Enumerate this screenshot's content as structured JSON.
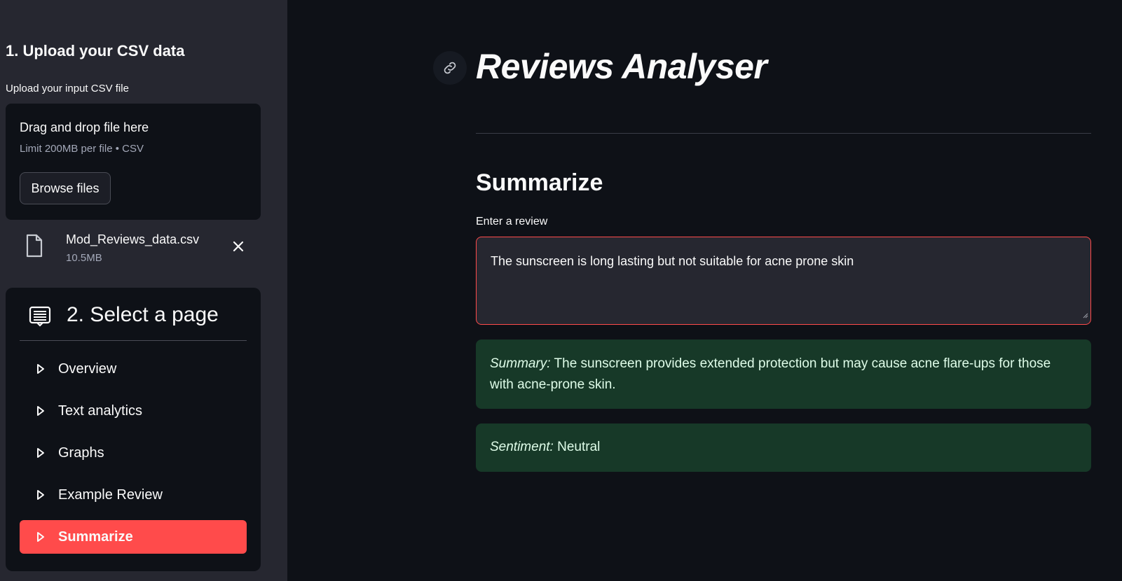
{
  "sidebar": {
    "upload_heading": "1. Upload your CSV data",
    "upload_label": "Upload your input CSV file",
    "dropzone": {
      "title": "Drag and drop file here",
      "limit": "Limit 200MB per file • CSV",
      "browse_label": "Browse files"
    },
    "file": {
      "name": "Mod_Reviews_data.csv",
      "size": "10.5MB"
    },
    "menu": {
      "title": "2. Select a page",
      "items": [
        {
          "label": "Overview",
          "active": false
        },
        {
          "label": "Text analytics",
          "active": false
        },
        {
          "label": "Graphs",
          "active": false
        },
        {
          "label": "Example Review",
          "active": false
        },
        {
          "label": "Summarize",
          "active": true
        }
      ]
    }
  },
  "main": {
    "title": "Reviews Analyser",
    "section_heading": "Summarize",
    "input_label": "Enter a review",
    "review_text": "The sunscreen is long lasting but not suitable for acne prone skin",
    "summary": {
      "label": "Summary:",
      "text": "The sunscreen provides extended protection but may cause acne flare-ups for those with acne-prone skin."
    },
    "sentiment": {
      "label": "Sentiment:",
      "text": "Neutral"
    }
  },
  "colors": {
    "background": "#0e1117",
    "sidebar": "#262730",
    "accent": "#ff4b4b",
    "success_bg": "#173928"
  }
}
